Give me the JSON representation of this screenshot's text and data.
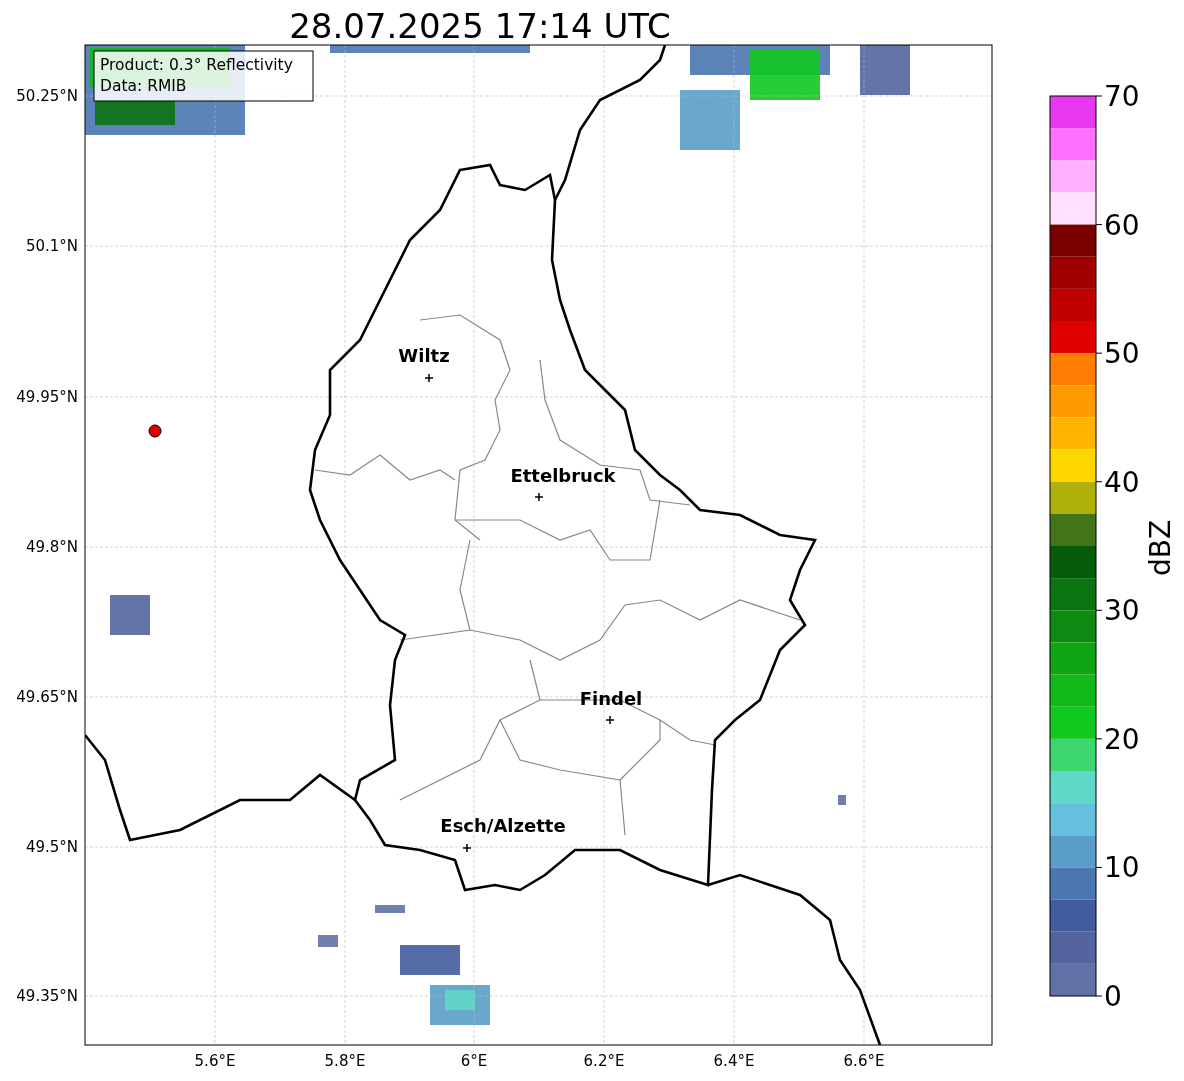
{
  "title": "28.07.2025 17:14 UTC",
  "info_box": [
    "Product: 0.3° Reflectivity",
    "Data: RMIB"
  ],
  "cities": [
    {
      "name": "Wiltz"
    },
    {
      "name": "Ettelbruck"
    },
    {
      "name": "Findel"
    },
    {
      "name": "Esch/Alzette"
    }
  ],
  "lat_ticks": [
    "50.25°N",
    "50.1°N",
    "49.95°N",
    "49.8°N",
    "49.65°N",
    "49.5°N",
    "49.35°N"
  ],
  "lon_ticks": [
    "5.6°E",
    "5.8°E",
    "6°E",
    "6.2°E",
    "6.4°E",
    "6.6°E"
  ],
  "colorbar": {
    "label": "dBZ",
    "ticks": [
      "70",
      "60",
      "50",
      "40",
      "30",
      "20",
      "10",
      "0"
    ],
    "bins": [
      {
        "color": "#e838f0"
      },
      {
        "color": "#ff70ff"
      },
      {
        "color": "#ffb0ff"
      },
      {
        "color": "#ffe0ff"
      },
      {
        "color": "#7a0000"
      },
      {
        "color": "#a00000"
      },
      {
        "color": "#c00000"
      },
      {
        "color": "#e00000"
      },
      {
        "color": "#ff7d00"
      },
      {
        "color": "#ff9b00"
      },
      {
        "color": "#ffb400"
      },
      {
        "color": "#ffd700"
      },
      {
        "color": "#b0b00a"
      },
      {
        "color": "#44741a"
      },
      {
        "color": "#075c0c"
      },
      {
        "color": "#0b7311"
      },
      {
        "color": "#0e8a12"
      },
      {
        "color": "#10a515"
      },
      {
        "color": "#10b81a"
      },
      {
        "color": "#10c81e"
      },
      {
        "color": "#3dd670"
      },
      {
        "color": "#5fd8c8"
      },
      {
        "color": "#64c0dc"
      },
      {
        "color": "#5a9dc8"
      },
      {
        "color": "#4a77b0"
      },
      {
        "color": "#435ca0"
      },
      {
        "color": "#53649f"
      },
      {
        "color": "#6272a6"
      }
    ]
  }
}
